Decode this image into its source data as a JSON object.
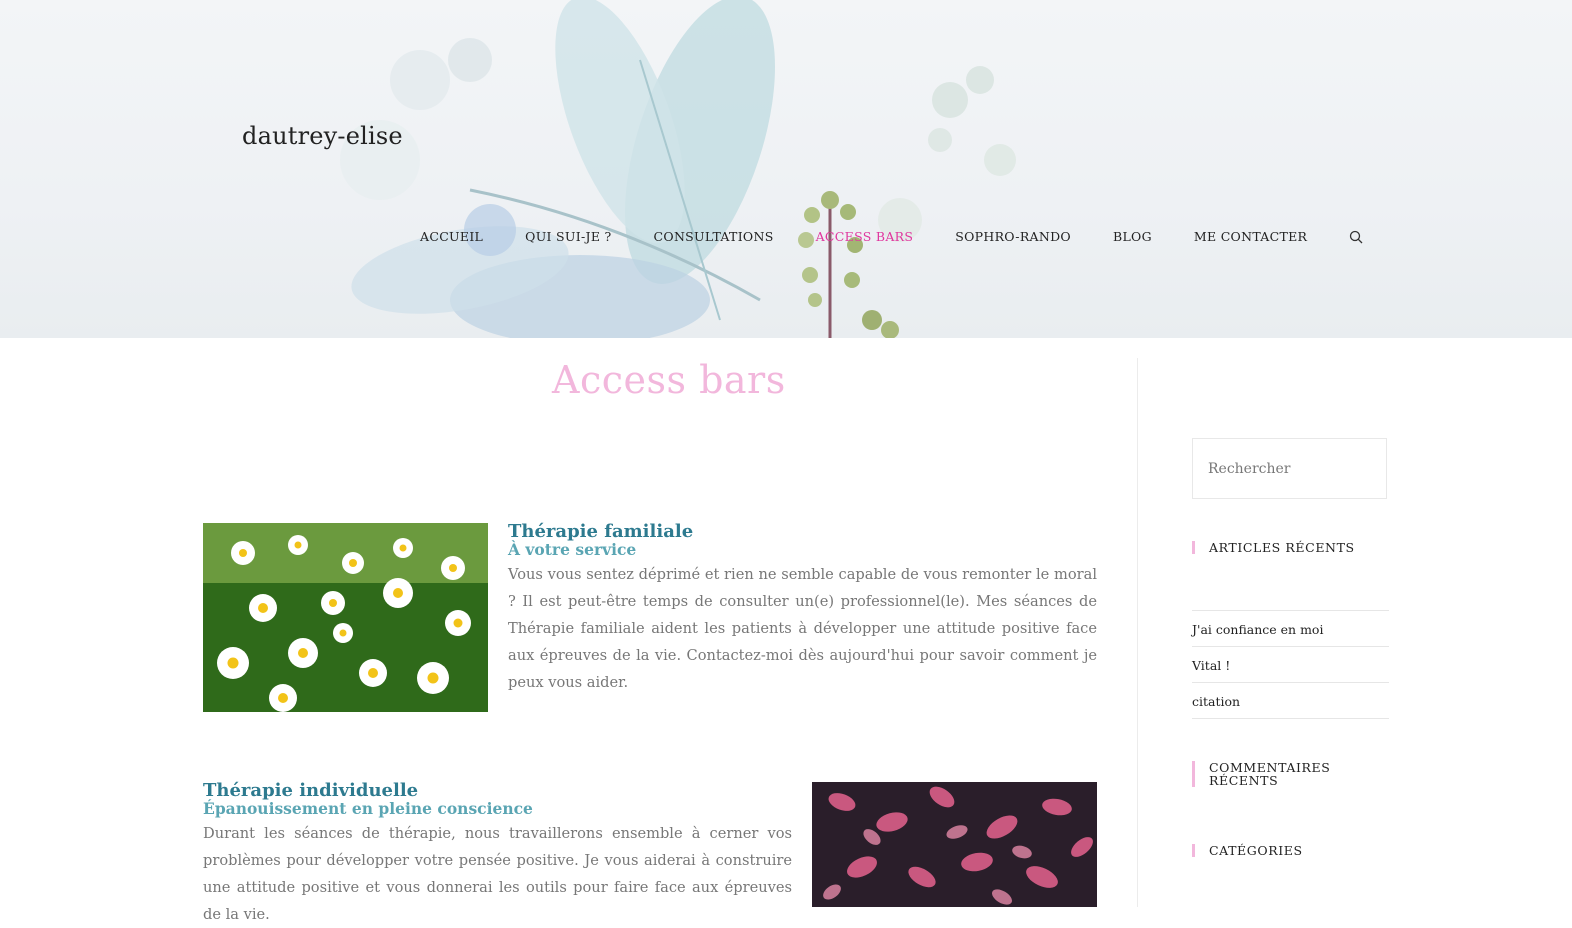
{
  "site": {
    "title": "dautrey-elise"
  },
  "nav": {
    "items": [
      "ACCUEIL",
      "QUI SUI-JE ?",
      "CONSULTATIONS",
      "ACCESS BARS",
      "SOPHRO-RANDO",
      "BLOG",
      "ME CONTACTER"
    ],
    "active_index": 3,
    "search_icon": "search-icon"
  },
  "main": {
    "page_title": "Access bars",
    "services": [
      {
        "title": "Thérapie familiale",
        "subtitle": "À votre service",
        "text": "Vous vous sentez déprimé et rien ne semble capable de vous remonter le moral ? Il est peut-être temps de consulter un(e) professionnel(le). Mes séances de Thérapie familiale aident les patients à développer une attitude positive face aux épreuves de la vie. Contactez-moi dès aujourd'hui pour savoir comment je peux vous aider."
      },
      {
        "title": "Thérapie individuelle",
        "subtitle": "Épanouissement en pleine conscience",
        "text": "Durant les séances de thérapie, nous travaillerons ensemble à cerner vos problèmes pour développer votre pensée positive. Je vous aiderai à construire une attitude positive et vous donnerai les outils pour faire face aux épreuves de la vie."
      }
    ]
  },
  "sidebar": {
    "search_placeholder": "Rechercher",
    "recent_articles_title": "ARTICLES RÉCENTS",
    "recent_articles": [
      "J'ai confiance en moi",
      "Vital !",
      "citation"
    ],
    "recent_comments_title": "COMMENTAIRES RÉCENTS",
    "categories_title": "CATÉGORIES"
  },
  "colors": {
    "accent_pink": "#e0369e",
    "title_pink": "#f2b7dc",
    "service_title": "#2d7a8f",
    "service_subtitle": "#5aa5b3"
  }
}
